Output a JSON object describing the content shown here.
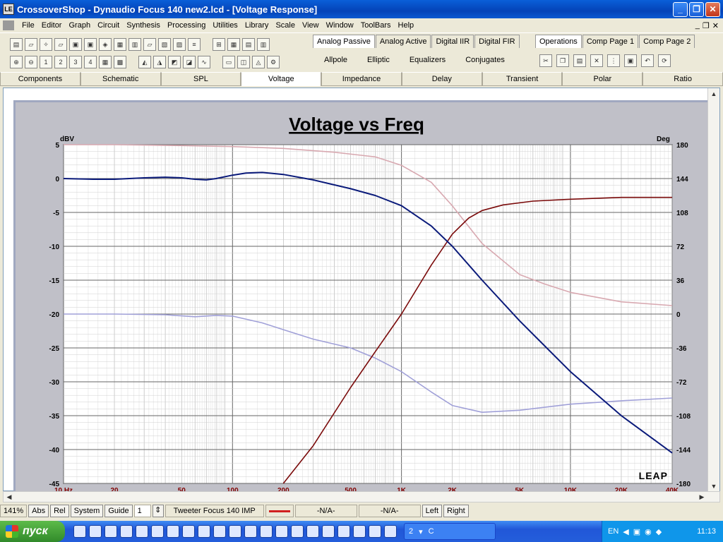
{
  "window": {
    "title": "CrossoverShop - Dynaudio Focus 140 new2.lcd - [Voltage Response]",
    "app_icon_text": "LE"
  },
  "menubar": {
    "items": [
      "File",
      "Editor",
      "Graph",
      "Circuit",
      "Synthesis",
      "Processing",
      "Utilities",
      "Library",
      "Scale",
      "View",
      "Window",
      "ToolBars",
      "Help"
    ]
  },
  "toolbar": {
    "analog_tabs": [
      "Analog Passive",
      "Analog Active",
      "Digital IIR",
      "Digital FIR"
    ],
    "analog_subtabs": [
      "Allpole",
      "Elliptic",
      "Equalizers",
      "Conjugates"
    ],
    "operations_tabs": [
      "Operations",
      "Comp Page 1",
      "Comp Page 2"
    ]
  },
  "view_tabs": [
    "Components",
    "Schematic",
    "SPL",
    "Voltage",
    "Impedance",
    "Delay",
    "Transient",
    "Polar",
    "Ratio"
  ],
  "selected_view": "Voltage",
  "chart_data": {
    "type": "line",
    "title": "Voltage vs Freq",
    "ylabel_left": "dBV",
    "ylabel_right": "Deg",
    "xscale": "log",
    "xlim": [
      10,
      40000
    ],
    "ylim_left": [
      -45,
      5
    ],
    "ylim_right": [
      -180,
      180
    ],
    "x_tick_labels": [
      "10 Hz",
      "20",
      "50",
      "100",
      "200",
      "500",
      "1K",
      "2K",
      "5K",
      "10K",
      "20K",
      "40K"
    ],
    "y_left_ticks": [
      "5",
      "0",
      "-5",
      "-10",
      "-15",
      "-20",
      "-25",
      "-30",
      "-35",
      "-40",
      "-45"
    ],
    "y_right_ticks": [
      "180",
      "144",
      "108",
      "72",
      "36",
      "0",
      "-36",
      "-72",
      "-108",
      "-144",
      "-180"
    ],
    "grid": true,
    "watermark": "LEAP",
    "series": [
      {
        "color": "#0a1a7a",
        "axis": "left",
        "x": [
          10,
          15,
          20,
          30,
          40,
          50,
          60,
          70,
          80,
          100,
          120,
          150,
          200,
          300,
          500,
          700,
          1000,
          1500,
          2000,
          3000,
          5000,
          10000,
          20000,
          40000
        ],
        "y": [
          0,
          -0.1,
          -0.1,
          0.1,
          0.2,
          0.1,
          -0.1,
          -0.2,
          0,
          0.5,
          0.8,
          0.9,
          0.6,
          -0.2,
          -1.5,
          -2.5,
          -4,
          -7,
          -10,
          -15,
          -21,
          -28.5,
          -35,
          -40.5
        ]
      },
      {
        "color": "#7a0a0a",
        "axis": "right",
        "x": [
          200,
          300,
          500,
          700,
          1000,
          1500,
          2000,
          2500,
          3000,
          4000,
          6000,
          10000,
          20000,
          40000
        ],
        "y": [
          -180,
          -140,
          -78,
          -40,
          0,
          52,
          85,
          102,
          110,
          116,
          120,
          122,
          124,
          124
        ]
      },
      {
        "color": "#d8a8b0",
        "axis": "right",
        "x": [
          10,
          20,
          50,
          100,
          200,
          400,
          700,
          1000,
          1500,
          2000,
          3000,
          5000,
          7000,
          10000,
          20000,
          40000
        ],
        "y": [
          180,
          180,
          179,
          178,
          176,
          172,
          167,
          158,
          140,
          115,
          75,
          42,
          32,
          23,
          13,
          9
        ]
      },
      {
        "color": "#a0a0d8",
        "axis": "left",
        "x": [
          10,
          20,
          40,
          60,
          80,
          100,
          150,
          200,
          300,
          500,
          700,
          1000,
          1500,
          2000,
          3000,
          5000,
          10000,
          20000,
          40000
        ],
        "y": [
          -20,
          -20,
          -20.1,
          -20.4,
          -20.2,
          -20.3,
          -21.3,
          -22.3,
          -23.7,
          -25,
          -26.5,
          -28.5,
          -31.5,
          -33.5,
          -34.5,
          -34.2,
          -33.3,
          -32.8,
          -32.4
        ]
      }
    ]
  },
  "status": {
    "zoom": "141%",
    "abs": "Abs",
    "rel": "Rel",
    "system": "System",
    "guide": "Guide",
    "guide_value": "1",
    "series_label": "Tweeter Focus 140 IMP",
    "na1": "-N/A-",
    "na2": "-N/A-",
    "left": "Left",
    "right": "Right"
  },
  "taskbar": {
    "start": "пуск",
    "task_count": "2",
    "task_label": "C",
    "lang": "EN",
    "time": "11:13"
  }
}
